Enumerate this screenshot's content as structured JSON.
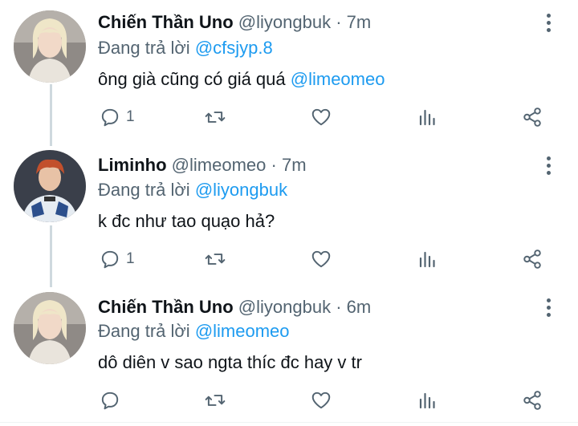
{
  "tweets": [
    {
      "name": "Chiến Thần Uno",
      "handle": "@liyongbuk",
      "separator": "·",
      "time": "7m",
      "reply_prefix": "Đang trả lời",
      "reply_to": "@cfsjyp.8",
      "text": "ông già cũng có giá quá",
      "text_mention": "@limeomeo",
      "reply_count": "1",
      "avatar_icon": "avatar-blonde"
    },
    {
      "name": "Liminho",
      "handle": "@limeomeo",
      "separator": "·",
      "time": "7m",
      "reply_prefix": "Đang trả lời",
      "reply_to": "@liyongbuk",
      "text": "k đc như tao quạo hả?",
      "text_mention": "",
      "reply_count": "1",
      "avatar_icon": "avatar-redhair"
    },
    {
      "name": "Chiến Thần Uno",
      "handle": "@liyongbuk",
      "separator": "·",
      "time": "6m",
      "reply_prefix": "Đang trả lời",
      "reply_to": "@limeomeo",
      "text": "dô diên v sao ngta thíc đc hay v tr",
      "text_mention": "",
      "reply_count": "",
      "avatar_icon": "avatar-blonde"
    }
  ],
  "icons": {
    "reply": "reply-icon",
    "retweet": "retweet-icon",
    "like": "heart-icon",
    "analytics": "analytics-icon",
    "share": "share-icon",
    "more": "more-icon"
  },
  "colors": {
    "accent": "#1d9bf0",
    "secondary_text": "#536471",
    "thread_line": "#cfd9de"
  }
}
